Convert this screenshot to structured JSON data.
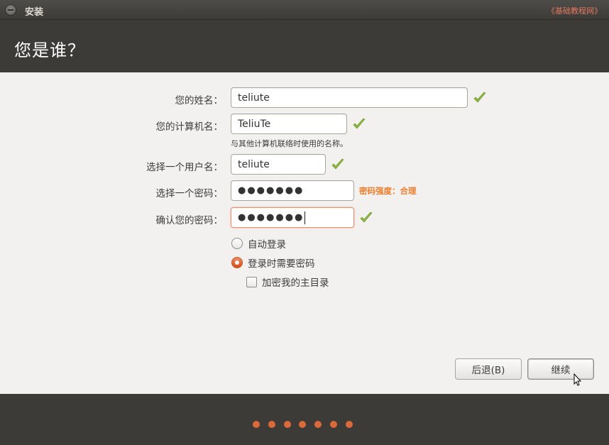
{
  "window": {
    "title": "安装",
    "watermark": "《基础教程网》"
  },
  "header": {
    "title": "您是谁？"
  },
  "form": {
    "name_label": "您的姓名：",
    "name_value": "teliute",
    "computer_label": "您的计算机名：",
    "computer_value": "TeliuTe",
    "computer_hint": "与其他计算机联络时使用的名称。",
    "username_label": "选择一个用户名：",
    "username_value": "teliute",
    "password_label": "选择一个密码：",
    "password_value": "●●●●●●●",
    "password_strength": "密码强度：合理",
    "confirm_label": "确认您的密码：",
    "confirm_value": "●●●●●●●"
  },
  "login_options": {
    "auto_login": "自动登录",
    "require_password": "登录时需要密码",
    "encrypt_home": "加密我的主目录",
    "selected": "require_password",
    "encrypt_checked": false
  },
  "buttons": {
    "back": "后退(B)",
    "continue": "继续"
  },
  "progress": {
    "step_count": 7
  },
  "colors": {
    "accent": "#dd4814",
    "strength": "#f07e2b",
    "check": "#8dba3d",
    "header_bg": "#3c3b37"
  }
}
